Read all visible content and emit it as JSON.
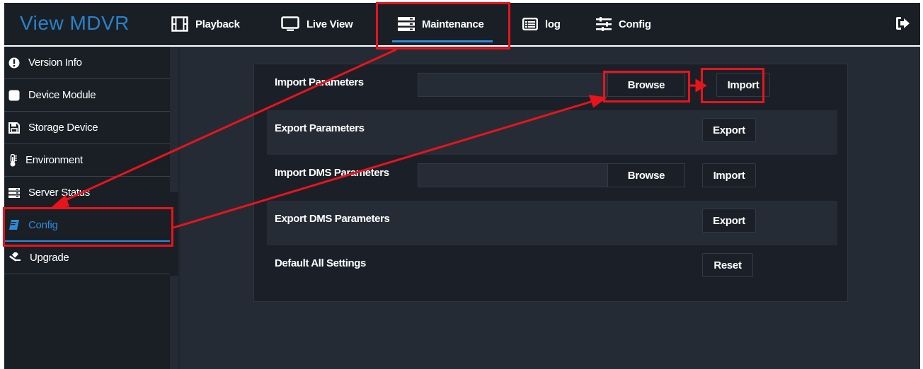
{
  "app": {
    "title": "View MDVR"
  },
  "nav": {
    "items": [
      {
        "label": "Playback",
        "icon": "film-icon"
      },
      {
        "label": "Live View",
        "icon": "monitor-icon"
      },
      {
        "label": "Maintenance",
        "icon": "server-icon",
        "active": true
      },
      {
        "label": "log",
        "icon": "list-icon"
      },
      {
        "label": "Config",
        "icon": "sliders-icon"
      }
    ],
    "exit_icon": "sign-out-icon"
  },
  "sidebar": {
    "items": [
      {
        "label": "Version Info",
        "icon": "exclamation-circle-icon"
      },
      {
        "label": "Device Module",
        "icon": "square-icon"
      },
      {
        "label": "Storage Device",
        "icon": "floppy-disk-icon"
      },
      {
        "label": "Environment",
        "icon": "thermometer-icon"
      },
      {
        "label": "Server Status",
        "icon": "server-icon"
      },
      {
        "label": "Config",
        "icon": "book-icon",
        "active": true
      },
      {
        "label": "Upgrade",
        "icon": "gavel-icon"
      }
    ]
  },
  "main": {
    "rows": [
      {
        "label": "Import Parameters",
        "file_value": "",
        "browse_label": "Browse",
        "button_label": "Import"
      },
      {
        "label": "Export Parameters",
        "button_label": "Export"
      },
      {
        "label": "Import DMS Parameters",
        "file_value": "",
        "browse_label": "Browse",
        "button_label": "Import"
      },
      {
        "label": "Export DMS Parameters",
        "button_label": "Export"
      },
      {
        "label": "Default All Settings",
        "button_label": "Reset"
      }
    ]
  },
  "colors": {
    "brand": "#2a82c9",
    "accent": "#2e8ad8",
    "annotation": "#e8141c",
    "nav_bg": "#1a1f26",
    "main_bg": "#252b34"
  }
}
